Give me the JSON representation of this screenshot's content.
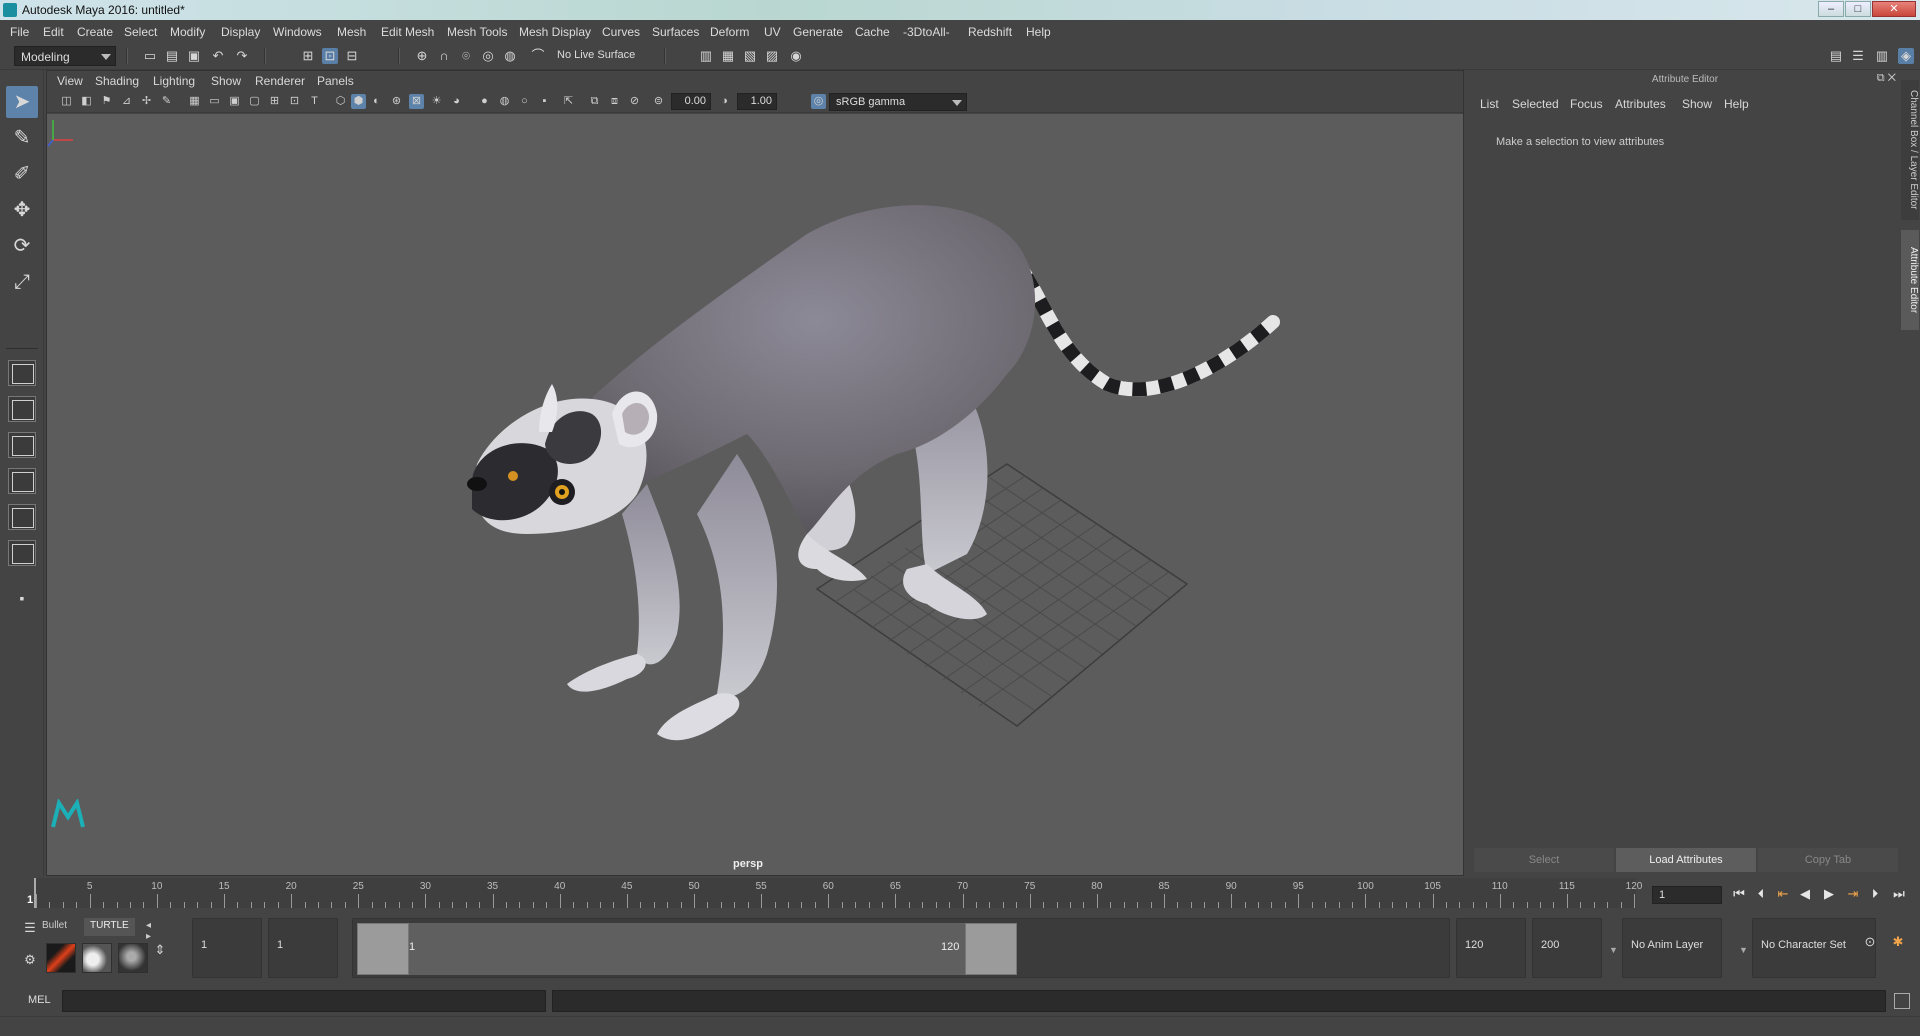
{
  "window": {
    "title": "Autodesk Maya 2016: untitled*",
    "minimize": "–",
    "maximize": "□",
    "close": "✕"
  },
  "menubar": [
    "File",
    "Edit",
    "Create",
    "Select",
    "Modify",
    "Display",
    "Windows",
    "Mesh",
    "Edit Mesh",
    "Mesh Tools",
    "Mesh Display",
    "Curves",
    "Surfaces",
    "Deform",
    "UV",
    "Generate",
    "Cache",
    "-3DtoAll-",
    "Redshift",
    "Help"
  ],
  "statusline": {
    "mode": "Modeling",
    "live_surface": "No Live Surface"
  },
  "panel": {
    "menu": [
      "View",
      "Shading",
      "Lighting",
      "Show",
      "Renderer",
      "Panels"
    ],
    "exposure": "0.00",
    "gamma": "1.00",
    "color_space": "sRGB gamma",
    "camera": "persp"
  },
  "attribute_editor": {
    "title": "Attribute Editor",
    "menu": [
      "List",
      "Selected",
      "Focus",
      "Attributes",
      "Show",
      "Help"
    ],
    "message": "Make a selection to view attributes",
    "buttons": {
      "select": "Select",
      "load": "Load Attributes",
      "copy": "Copy Tab"
    }
  },
  "side_tabs": {
    "channel_box": "Channel Box / Layer Editor",
    "attribute_editor": "Attribute Editor"
  },
  "timeslider": {
    "ticks": [
      "1",
      "5",
      "10",
      "15",
      "20",
      "25",
      "30",
      "35",
      "40",
      "45",
      "50",
      "55",
      "60",
      "65",
      "70",
      "75",
      "80",
      "85",
      "90",
      "95",
      "100",
      "105",
      "110",
      "115",
      "120"
    ],
    "current_frame": "1",
    "frame_field": "1"
  },
  "shelf": {
    "tabs": [
      "Bullet",
      "TURTLE"
    ]
  },
  "range": {
    "start": "1",
    "playback_start": "1",
    "range_start_label": "1",
    "range_end_label": "120",
    "playback_end": "120",
    "end": "200",
    "anim_layer": "No Anim Layer",
    "character_set": "No Character Set"
  },
  "cmdline": {
    "label": "MEL"
  },
  "colors": {
    "accent": "#5d83aa",
    "viewport_bg": "#5c5c5c",
    "key_highlight": "#f2a54b"
  }
}
